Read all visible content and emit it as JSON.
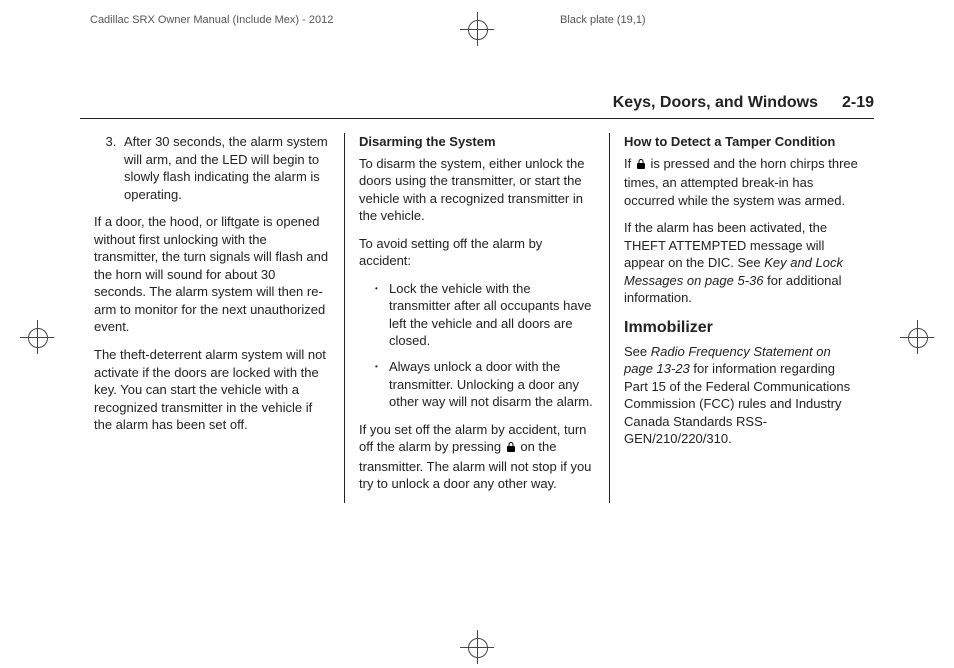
{
  "print": {
    "manual": "Cadillac SRX Owner Manual (Include Mex) - 2012",
    "plate": "Black plate (19,1)"
  },
  "header": {
    "section": "Keys, Doors, and Windows",
    "page": "2-19"
  },
  "col1": {
    "ol_start": 3,
    "li3": "After 30 seconds, the alarm system will arm, and the LED will begin to slowly flash indicating the alarm is operating.",
    "p1": "If a door, the hood, or liftgate is opened without first unlocking with the transmitter, the turn signals will flash and the horn will sound for about 30 seconds. The alarm system will then re-arm to monitor for the next unauthorized event.",
    "p2": "The theft-deterrent alarm system will not activate if the doors are locked with the key. You can start the vehicle with a recognized transmitter in the vehicle if the alarm has been set off."
  },
  "col2": {
    "h_disarm": "Disarming the System",
    "p1": "To disarm the system, either unlock the doors using the transmitter, or start the vehicle with a recognized transmitter in the vehicle.",
    "p2": "To avoid setting off the alarm by accident:",
    "b1": "Lock the vehicle with the transmitter after all occupants have left the vehicle and all doors are closed.",
    "b2": "Always unlock a door with the transmitter. Unlocking a door any other way will not disarm the alarm.",
    "p3a": "If you set off the alarm by accident, turn off the alarm by pressing ",
    "p3b": " on the transmitter. The alarm will not stop if you try to unlock a door any other way."
  },
  "col3": {
    "h_tamper": "How to Detect a Tamper Condition",
    "p1a": "If ",
    "p1b": " is pressed and the horn chirps three times, an attempted break-in has occurred while the system was armed.",
    "p2a": "If the alarm has been activated, the THEFT ATTEMPTED message will appear on the DIC. See ",
    "p2ref": "Key and Lock Messages on page 5-36",
    "p2b": " for additional information.",
    "h_immob": "Immobilizer",
    "p3a": "See ",
    "p3ref": "Radio Frequency Statement on page 13-23",
    "p3b": " for information regarding Part 15 of the Federal Communications Commission (FCC) rules and Industry Canada Standards RSS-GEN/210/220/310."
  }
}
